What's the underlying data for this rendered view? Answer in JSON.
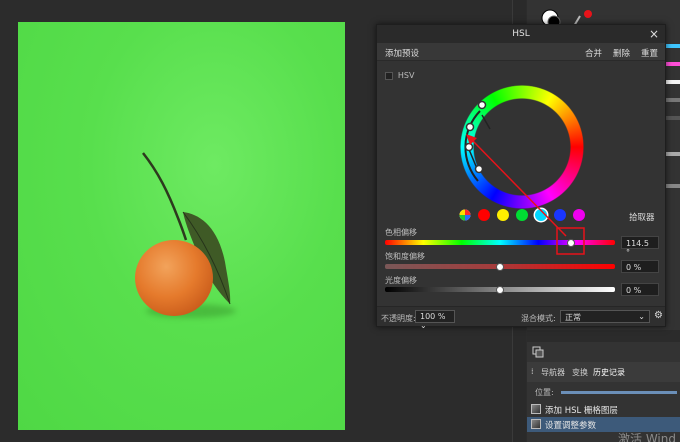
{
  "hsl_dialog": {
    "title": "HSL",
    "close": "×",
    "add_preset": "添加预设",
    "merge": "合并",
    "delete": "删除",
    "reset": "重置",
    "hsv_label": "HSV",
    "picker": "拾取器",
    "hue_label": "色相偏移",
    "hue_value": "114.5 °",
    "hue_level_fraction": 0.81,
    "sat_label": "饱和度偏移",
    "sat_value": "0 %",
    "sat_level_fraction": 0.5,
    "light_label": "光度偏移",
    "light_value": "0 %",
    "light_level_fraction": 0.5,
    "opacity_label": "不透明度:",
    "opacity_value": "100 % ⌄",
    "blend_label": "混合模式:",
    "blend_value": "正常",
    "color_options": [
      "all",
      "red",
      "yellow",
      "green",
      "cyan",
      "blue",
      "magenta"
    ],
    "color_hex": [
      "#ff0000",
      "#ffee00",
      "#00dd33",
      "#00d7ff",
      "#1a36ff",
      "#ee00ee"
    ]
  },
  "panel": {
    "tabs": [
      "导航器",
      "变换",
      "历史记录"
    ],
    "position_label": "位置:",
    "history": [
      "添加 HSL 栅格图层",
      "设置调整参数"
    ]
  },
  "watermark": "激活 Wind",
  "accent": "#e8131a"
}
